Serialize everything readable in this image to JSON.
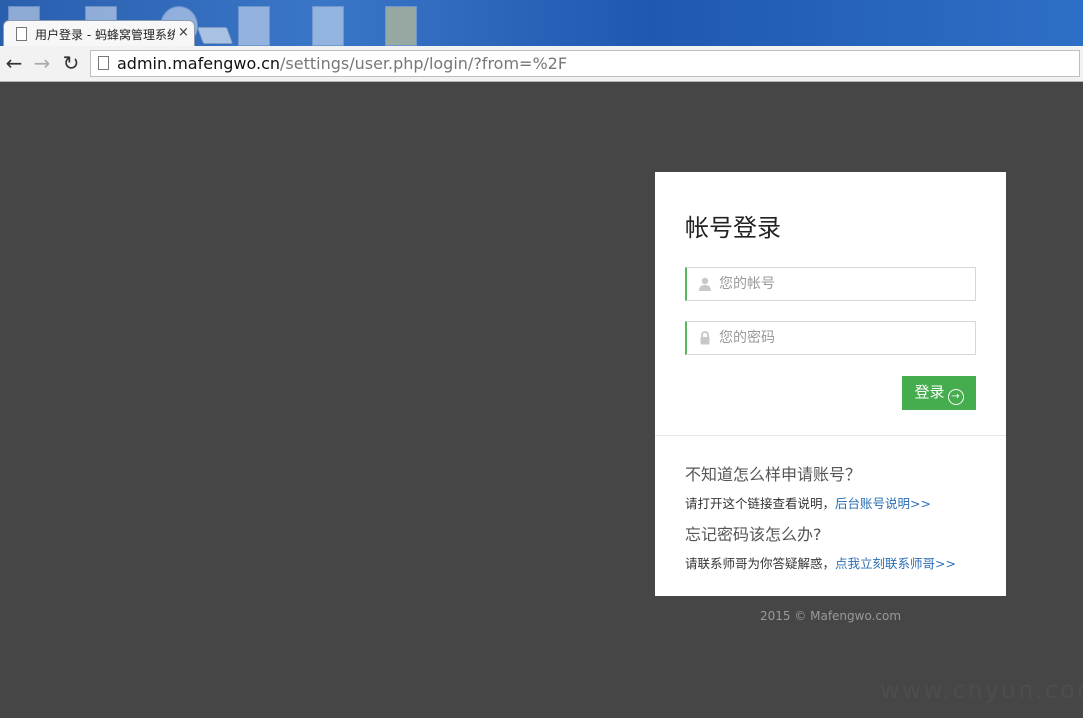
{
  "browser": {
    "tab_title": "用户登录 - 蚂蜂窝管理系统",
    "tab_close": "×",
    "url_host": "admin.mafengwo.cn",
    "url_path": "/settings/user.php/login/?from=%2F",
    "back_glyph": "←",
    "forward_glyph": "→",
    "reload_glyph": "↻"
  },
  "login": {
    "title": "帐号登录",
    "account_placeholder": "您的帐号",
    "password_placeholder": "您的密码",
    "submit_label": "登录",
    "accent_color": "#45ad4d"
  },
  "help": {
    "q1": "不知道怎么样申请账号？",
    "a1_text": "请打开这个链接查看说明，",
    "a1_link": "后台账号说明>>",
    "q2": "忘记密码该怎么办?",
    "a2_text": "请联系师哥为你答疑解惑，",
    "a2_link": "点我立刻联系师哥>>",
    "link_color": "#2a6eb5"
  },
  "footer": {
    "copyright": "2015 © Mafengwo.com"
  },
  "watermark": "www.cnyun.com"
}
